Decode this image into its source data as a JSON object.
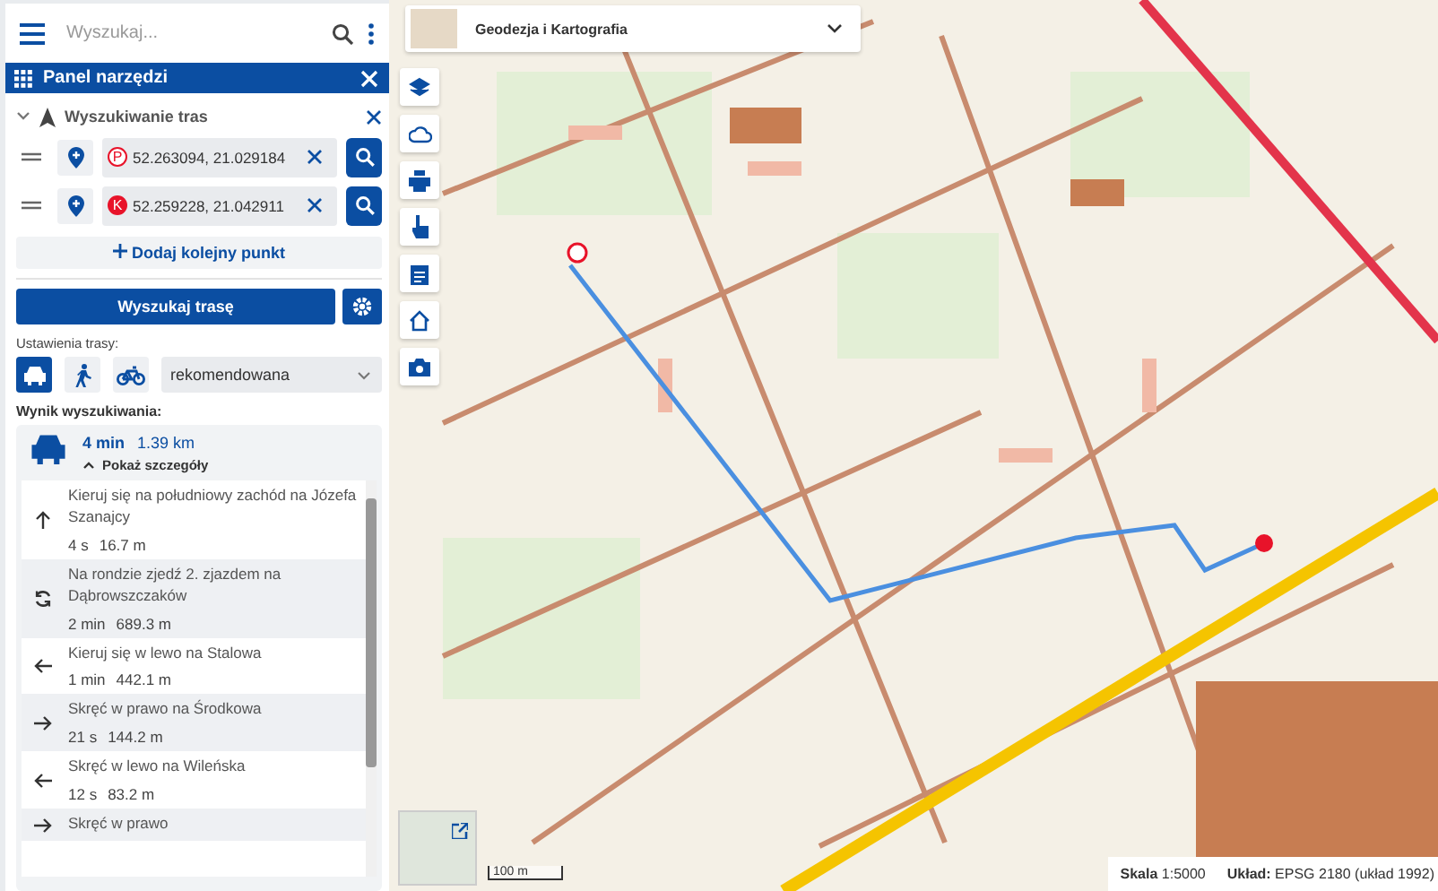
{
  "search": {
    "placeholder": "Wyszukaj..."
  },
  "tool_panel": {
    "title": "Panel narzędzi"
  },
  "route_search": {
    "title": "Wyszukiwanie tras",
    "expanded": true,
    "points": [
      {
        "marker": "P",
        "kind": "start",
        "value": "52.263094, 21.029184"
      },
      {
        "marker": "K",
        "kind": "end",
        "value": "52.259228, 21.042911"
      }
    ],
    "add_point": "Dodaj kolejny punkt",
    "search_button": "Wyszukaj trasę",
    "settings_label": "Ustawienia trasy:",
    "modes": [
      {
        "kind": "car",
        "selected": true
      },
      {
        "kind": "walk",
        "selected": false
      },
      {
        "kind": "bike",
        "selected": false
      }
    ],
    "route_type": "rekomendowana",
    "result_label": "Wynik wyszukiwania:",
    "summary": {
      "time": "4 min",
      "distance": "1.39 km",
      "details_toggle": "Pokaż szczegóły"
    },
    "steps": [
      {
        "kind": "straight",
        "instruction": "Kieruj się na południowy zachód na Józefa Szanajcy",
        "time": "4 s",
        "distance": "16.7 m"
      },
      {
        "kind": "roundabout",
        "instruction": "Na rondzie zjedź 2. zjazdem na Dąbrowszczaków",
        "time": "2 min",
        "distance": "689.3 m"
      },
      {
        "kind": "left",
        "instruction": "Kieruj się w lewo na Stalowa",
        "time": "1 min",
        "distance": "442.1 m"
      },
      {
        "kind": "right",
        "instruction": "Skręć w prawo na Środkowa",
        "time": "21 s",
        "distance": "144.2 m"
      },
      {
        "kind": "left",
        "instruction": "Skręć w lewo na Wileńska",
        "time": "12 s",
        "distance": "83.2 m"
      },
      {
        "kind": "right",
        "instruction": "Skręć w prawo"
      }
    ]
  },
  "map": {
    "layer": "Geodezja i Kartografia",
    "scale_bar": "100 m",
    "status": {
      "scale_label": "Skala",
      "scale": "1:5000",
      "crs_label": "Układ:",
      "crs": "EPSG 2180 (układ 1992)"
    }
  }
}
